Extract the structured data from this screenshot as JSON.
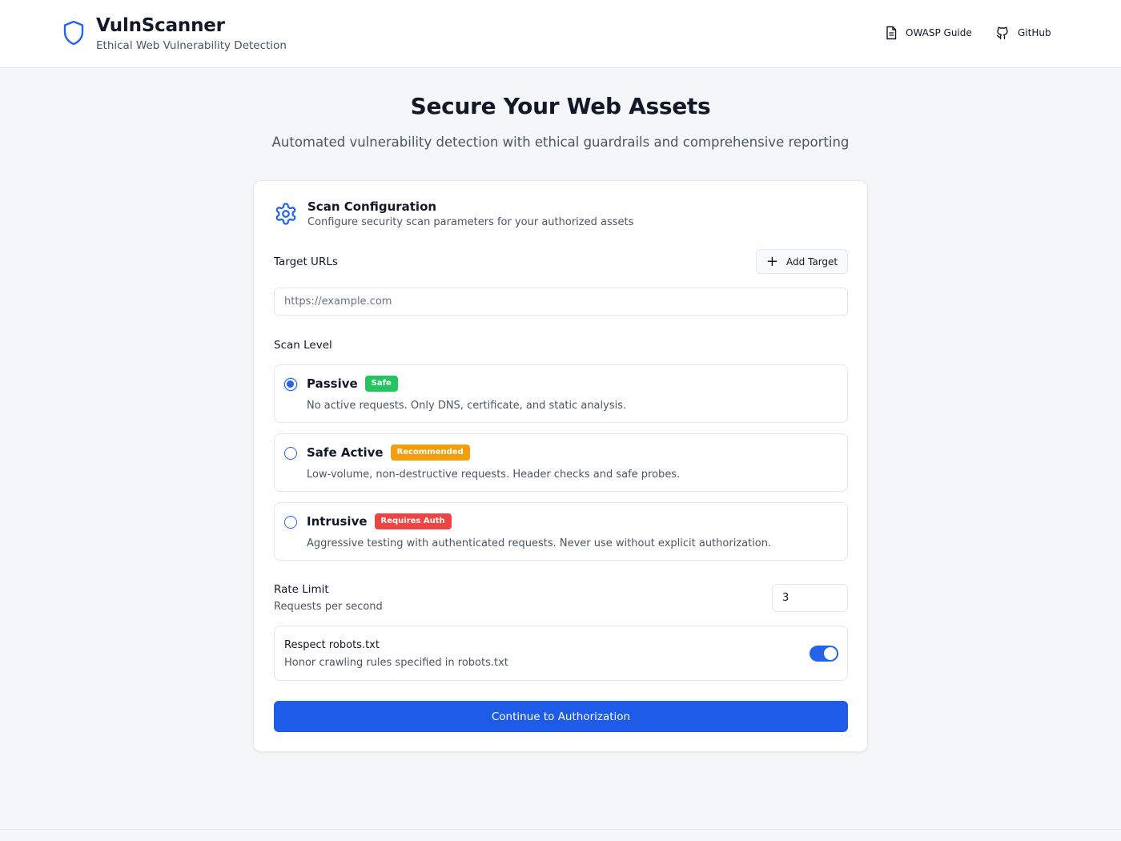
{
  "header": {
    "app_name": "VulnScanner",
    "tagline": "Ethical Web Vulnerability Detection",
    "logo_icon": "shield-icon",
    "nav": [
      {
        "label": "OWASP Guide",
        "icon": "document-icon"
      },
      {
        "label": "GitHub",
        "icon": "github-icon"
      }
    ]
  },
  "hero": {
    "title": "Secure Your Web Assets",
    "subtitle": "Automated vulnerability detection with ethical guardrails and comprehensive reporting"
  },
  "config": {
    "title": "Scan Configuration",
    "subtitle": "Configure security scan parameters for your authorized assets",
    "icon": "gear-icon",
    "targets_label": "Target URLs",
    "add_target_label": "Add Target",
    "url_placeholder": "https://example.com",
    "url_value": "",
    "scan_level_label": "Scan Level",
    "levels": [
      {
        "title": "Passive",
        "badge": "Safe",
        "badge_color": "#22c55e",
        "description": "No active requests. Only DNS, certificate, and static analysis.",
        "selected": true
      },
      {
        "title": "Safe Active",
        "badge": "Recommended",
        "badge_color": "#f59e0b",
        "description": "Low-volume, non-destructive requests. Header checks and safe probes.",
        "selected": false
      },
      {
        "title": "Intrusive",
        "badge": "Requires Auth",
        "badge_color": "#ef4444",
        "description": "Aggressive testing with authenticated requests. Never use without explicit authorization.",
        "selected": false
      }
    ],
    "rate_limit_label": "Rate Limit",
    "rate_limit_sub": "Requests per second",
    "rate_limit_value": "3",
    "robots_title": "Respect robots.txt",
    "robots_sub": "Honor crawling rules specified in robots.txt",
    "robots_enabled": true,
    "continue_label": "Continue to Authorization"
  },
  "colors": {
    "accent": "#2563eb",
    "button": "#1d5be8"
  }
}
